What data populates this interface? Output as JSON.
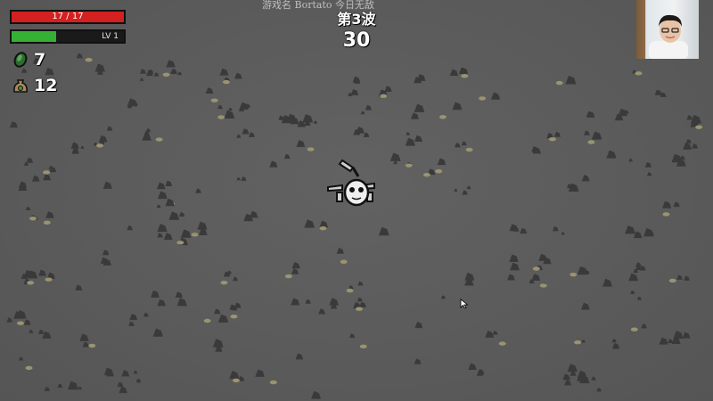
{
  "stream_overlay": {
    "title": "游戏名 Bortato 今日无敌"
  },
  "hud": {
    "hp": {
      "text": "17 / 17",
      "current": 17,
      "max": 17,
      "color": "#d32020"
    },
    "xp": {
      "level_text": "LV 1",
      "progress": 0.4,
      "color": "#35b035"
    },
    "materials": {
      "icon": "green-material-icon",
      "count": "7"
    },
    "bag": {
      "icon": "material-bag-icon",
      "count": "12"
    }
  },
  "wave": {
    "label": "第3波",
    "timer": "30"
  },
  "colors": {
    "ground": "#5b5b5b",
    "rock": "#3a3a3a",
    "moss": "#9a9370"
  }
}
